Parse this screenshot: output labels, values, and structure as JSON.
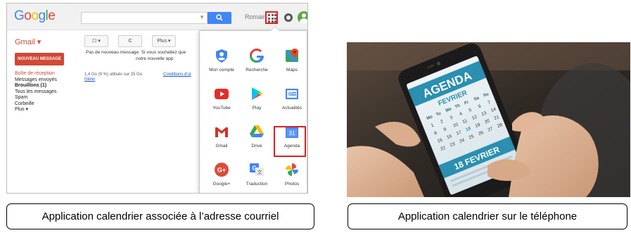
{
  "gmail": {
    "logo": [
      "G",
      "o",
      "o",
      "g",
      "l",
      "e"
    ],
    "logo_colors": [
      "#4285f4",
      "#ea4335",
      "#fbbc05",
      "#4285f4",
      "#34a853",
      "#ea4335"
    ],
    "user": "Romain",
    "label": "Gmail ▾",
    "toolbar": {
      "select": "☐ ▾",
      "refresh": "C",
      "more": "Plus ▾"
    },
    "compose": "NOUVEAU MESSAGE",
    "folders": [
      {
        "label": "Boîte de réception",
        "style": "active"
      },
      {
        "label": "Messages envoyés",
        "style": ""
      },
      {
        "label": "Brouillons (1)",
        "style": "bold"
      },
      {
        "label": "Tous les messages",
        "style": ""
      },
      {
        "label": "Spam",
        "style": ""
      },
      {
        "label": "Corbeille",
        "style": ""
      },
      {
        "label": "Plus ▾",
        "style": ""
      }
    ],
    "message_line1": "Pas de nouveau message. Si vous souhaitez que",
    "message_line2": "notre nouvelle app",
    "storage_line": "1,4 Go (9 %) utilisés sur 15 Go",
    "storage_link": "Gérer",
    "conditions": "Conditions d'ut",
    "apps": [
      {
        "name": "Mon compte",
        "icon": "account-shield-icon"
      },
      {
        "name": "Recherche",
        "icon": "google-g-icon"
      },
      {
        "name": "Maps",
        "icon": "maps-pin-icon"
      },
      {
        "name": "YouTube",
        "icon": "youtube-play-icon"
      },
      {
        "name": "Play",
        "icon": "play-store-icon"
      },
      {
        "name": "Actualités",
        "icon": "news-icon"
      },
      {
        "name": "Gmail",
        "icon": "gmail-m-icon"
      },
      {
        "name": "Drive",
        "icon": "drive-triangle-icon"
      },
      {
        "name": "Agenda",
        "icon": "calendar-31-icon"
      },
      {
        "name": "Google+",
        "icon": "google-plus-icon"
      },
      {
        "name": "Traduction",
        "icon": "translate-icon"
      },
      {
        "name": "Photos",
        "icon": "photos-pinwheel-icon"
      }
    ],
    "calendar_day": "31",
    "accent_red": "#e01e1e"
  },
  "phone": {
    "title": "AGENDA",
    "month": "FEVRIER",
    "weekdays": [
      "Mo",
      "Tu",
      "We",
      "Th",
      "Fr",
      "Sa",
      "Su"
    ],
    "days": [
      "1",
      "2",
      "3",
      "4",
      "5",
      "6",
      "7",
      "8",
      "9",
      "10",
      "11",
      "12",
      "13",
      "14",
      "15",
      "16",
      "17",
      "18",
      "19",
      "20",
      "21",
      "22",
      "23",
      "24",
      "25",
      "26",
      "27",
      "28"
    ],
    "date_banner": "18 FEVRIER"
  },
  "captions": {
    "left": "Application calendrier associée à l’adresse courriel",
    "right": "Application calendrier sur le téléphone"
  }
}
